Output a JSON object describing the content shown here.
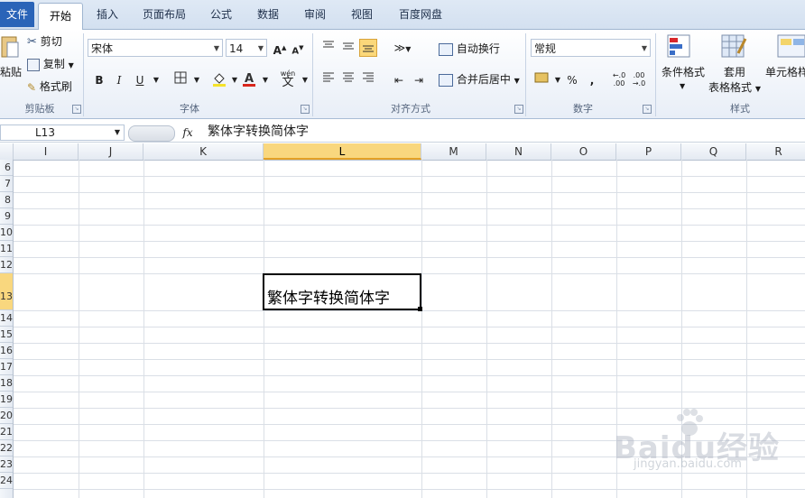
{
  "tabs": {
    "file": "文件",
    "home": "开始",
    "insert": "插入",
    "page_layout": "页面布局",
    "formulas": "公式",
    "data": "数据",
    "review": "审阅",
    "view": "视图",
    "baidu_netdisk": "百度网盘"
  },
  "clipboard": {
    "paste": "粘贴",
    "cut": "剪切",
    "copy": "复制",
    "format_painter": "格式刷",
    "label": "剪贴板"
  },
  "font": {
    "name": "宋体",
    "size": "14",
    "bold": "B",
    "italic": "I",
    "underline": "U",
    "label": "字体",
    "phonetic": "wén"
  },
  "alignment": {
    "wrap_text": "自动换行",
    "merge_center": "合并后居中",
    "label": "对齐方式"
  },
  "number": {
    "format": "常规",
    "percent": "%",
    "comma": ",",
    "label": "数字"
  },
  "styles": {
    "conditional_formatting": "条件格式",
    "format_as_table_line1": "套用",
    "format_as_table_line2": "表格格式",
    "cell_styles": "单元格样",
    "label": "样式"
  },
  "formula_bar": {
    "name_box": "L13",
    "fx": "fx",
    "content": "繁体字转换简体字"
  },
  "columns": [
    "I",
    "J",
    "K",
    "L",
    "M",
    "N",
    "O",
    "P",
    "Q",
    "R"
  ],
  "selected_column": "L",
  "rows": [
    "6",
    "7",
    "8",
    "9",
    "10",
    "11",
    "12",
    "13",
    "14",
    "15",
    "16",
    "17",
    "18",
    "19",
    "20",
    "21",
    "22",
    "23",
    "24"
  ],
  "selected_row": "13",
  "cell_L13": "繁体字转换简体字",
  "watermark": {
    "main": "Baidu经验",
    "sub": "jingyan.baidu.com"
  }
}
